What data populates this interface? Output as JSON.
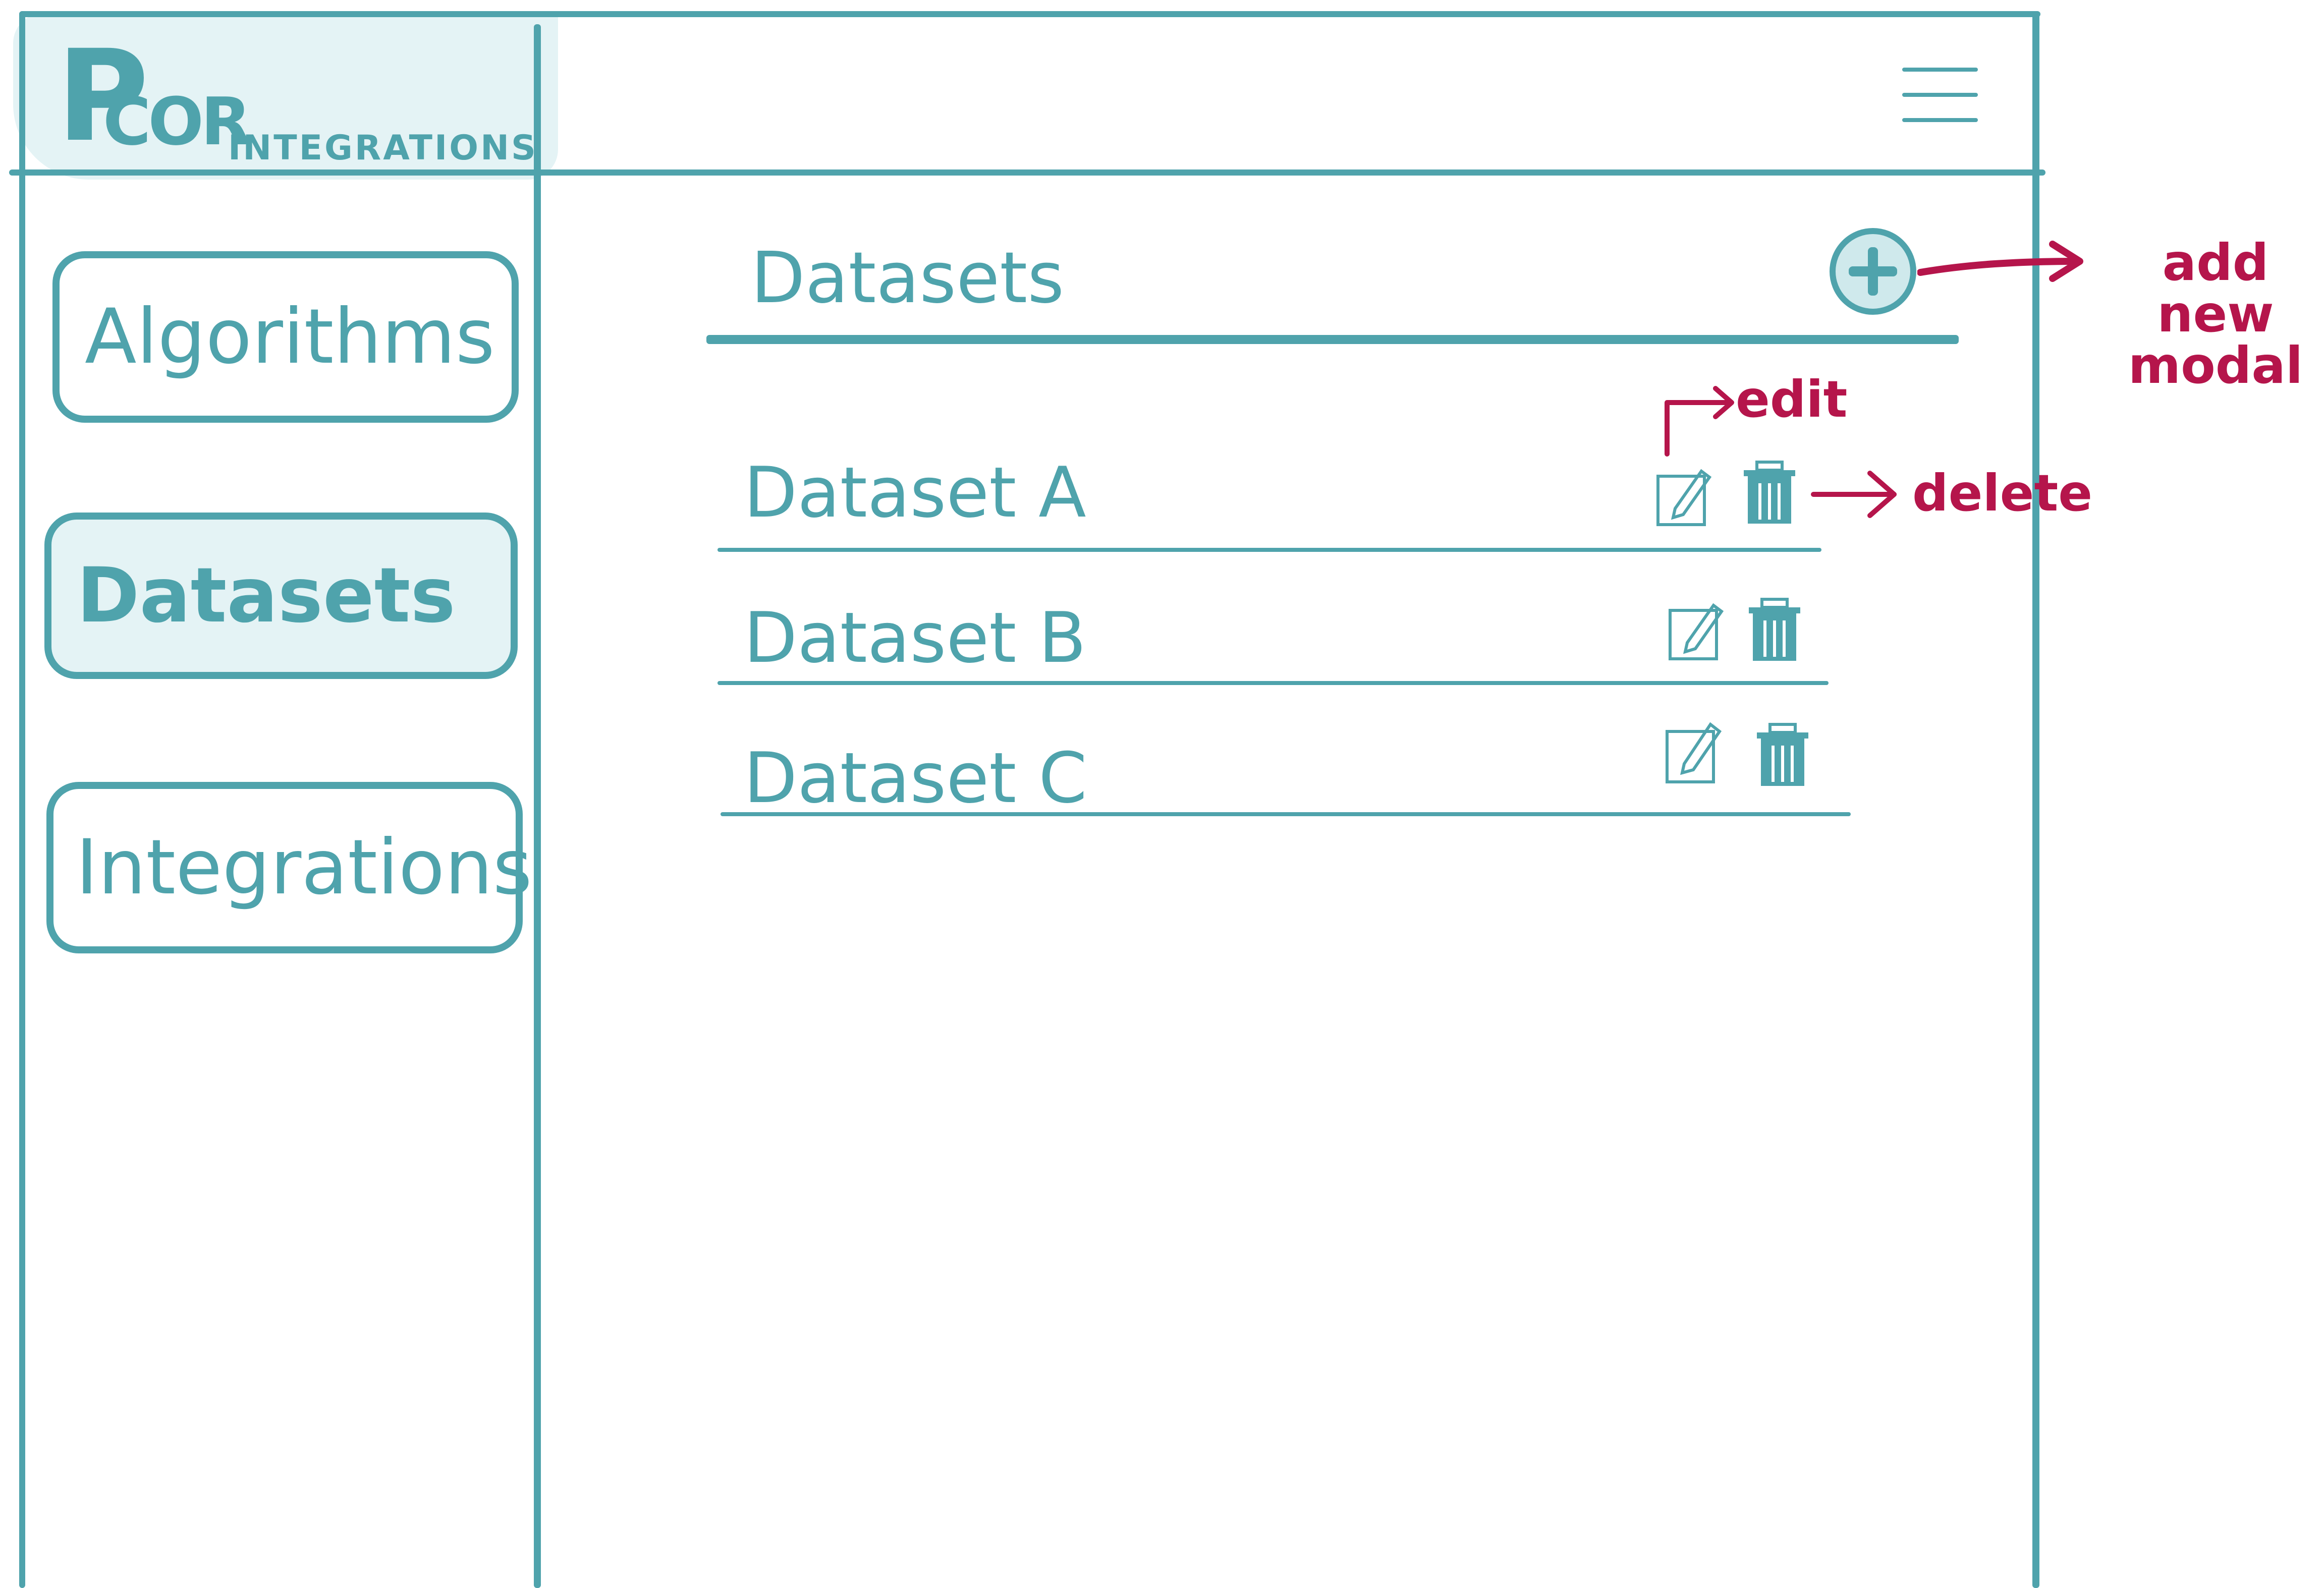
{
  "logo": {
    "initial": "P",
    "mark": "COR",
    "subtitle": "INTEGRATIONS"
  },
  "header": {
    "menu_icon": "hamburger-icon"
  },
  "sidebar": {
    "items": [
      {
        "label": "Algorithms",
        "selected": false
      },
      {
        "label": "Datasets",
        "selected": true
      },
      {
        "label": "Integrations",
        "selected": false
      }
    ]
  },
  "main": {
    "title": "Datasets",
    "add_icon": "plus-circle-icon",
    "rows": [
      {
        "label": "Dataset A",
        "edit_icon": "edit-icon",
        "delete_icon": "trash-icon"
      },
      {
        "label": "Dataset B",
        "edit_icon": "edit-icon",
        "delete_icon": "trash-icon"
      },
      {
        "label": "Dataset C",
        "edit_icon": "edit-icon",
        "delete_icon": "trash-icon"
      }
    ]
  },
  "annotations": {
    "add": "add new modal",
    "edit": "edit",
    "delete": "delete"
  },
  "colors": {
    "primary": "#4fa3ac",
    "selected_fill": "#e4f3f5",
    "annotation": "#b5154b"
  }
}
